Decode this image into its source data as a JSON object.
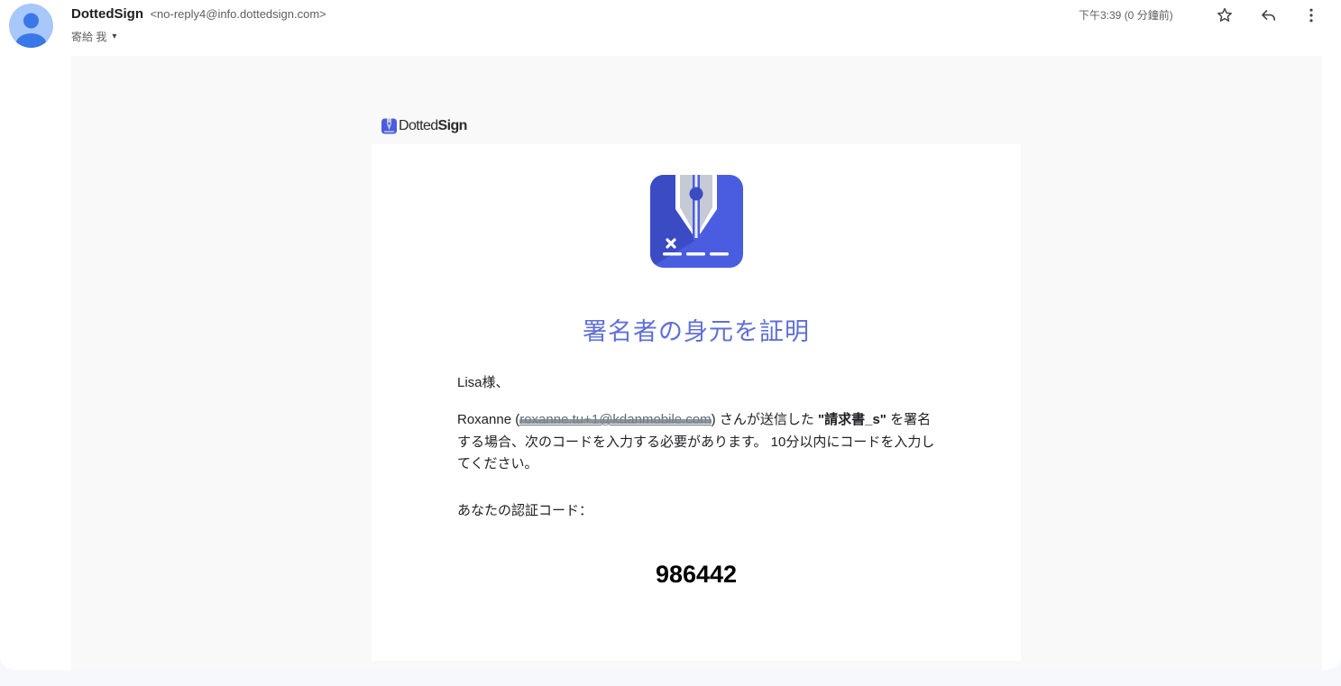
{
  "header": {
    "sender_name": "DottedSign",
    "sender_email": "<no-reply4@info.dottedsign.com>",
    "recipient": "寄給 我",
    "caret_icon": "▾",
    "timestamp": "下午3:39 (0 分鐘前)",
    "icons": [
      "star-icon",
      "reply-icon",
      "more-vert-icon"
    ]
  },
  "email": {
    "brand_regular": "Dotted",
    "brand_bold": "Sign",
    "title": "署名者の身元を証明",
    "greeting": "Lisa様、",
    "body_start": "Roxanne (",
    "masked_email": "roxanne.tu+1@kdanmobile.com",
    "body_after_email": ") さんが送信した ",
    "doc_name": "\"請求書_s\"",
    "body_end": " を署名する場合、次のコードを入力する必要があります。 10分以内にコードを入力してください。",
    "code_label": "あなたの認証コード：",
    "code": "986442"
  },
  "colors": {
    "title": "#5f6fd9",
    "icon_blue": "#4a5de0",
    "avatar": "#a8c7fa"
  }
}
